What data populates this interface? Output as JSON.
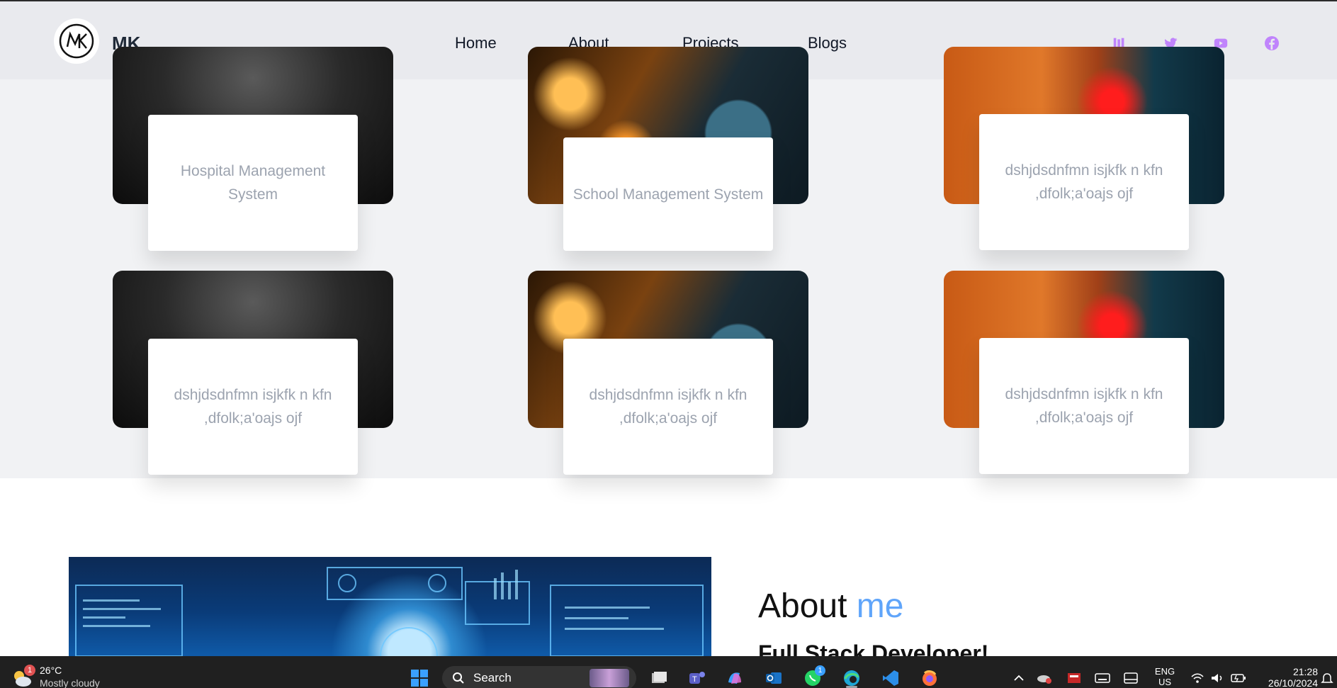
{
  "header": {
    "brand": "MK",
    "nav": [
      "Home",
      "About",
      "Projects",
      "Blogs"
    ],
    "social_icons": [
      "medium-icon",
      "twitter-icon",
      "youtube-icon",
      "facebook-icon"
    ],
    "accent_color": "#c084fc"
  },
  "projects": [
    {
      "title": "Hospital Management System",
      "image": "dark-room"
    },
    {
      "title": "School Management System",
      "image": "dashboard-laptop"
    },
    {
      "title": "dshjdsdnfmn isjkfk n kfn ,dfolk;a'oajs ojf",
      "image": "warehouse-robot"
    },
    {
      "title": "dshjdsdnfmn isjkfk n kfn ,dfolk;a'oajs ojf",
      "image": "dark-room"
    },
    {
      "title": "dshjdsdnfmn isjkfk n kfn ,dfolk;a'oajs ojf",
      "image": "dashboard-laptop"
    },
    {
      "title": "dshjdsdnfmn isjkfk n kfn ,dfolk;a'oajs ojf",
      "image": "warehouse-robot"
    }
  ],
  "about": {
    "title_main": "About",
    "title_accent": "me",
    "subtitle": "Full Stack Developer!",
    "accent_color": "#60a5fa"
  },
  "taskbar": {
    "weather_temp": "26°C",
    "weather_desc": "Mostly cloudy",
    "weather_badge": "1",
    "search_label": "Search",
    "whatsapp_badge": "1",
    "language_top": "ENG",
    "language_bottom": "US",
    "time": "21:28",
    "date": "26/10/2024"
  }
}
